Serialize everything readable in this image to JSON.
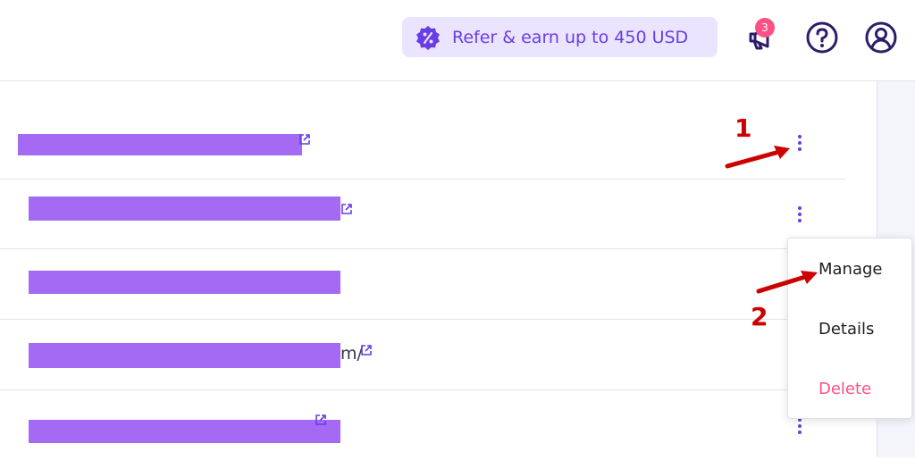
{
  "header": {
    "refer_label": "Refer & earn up to 450 USD",
    "notification_count": "3",
    "icons": [
      "discount-badge-icon",
      "megaphone-icon",
      "help-icon",
      "account-icon"
    ]
  },
  "rows": [
    {
      "url_visible": "",
      "has_external_link": true
    },
    {
      "url_visible": "",
      "has_external_link": true
    },
    {
      "url_visible": "",
      "has_external_link": false
    },
    {
      "url_visible": "m/",
      "has_external_link": true
    },
    {
      "url_visible": "",
      "has_external_link": true
    }
  ],
  "menu": {
    "manage": "Manage",
    "details": "Details",
    "delete": "Delete"
  },
  "annotations": {
    "step1": "1",
    "step2": "2"
  },
  "colors": {
    "accent": "#673de6",
    "accent_light": "#ebe4ff",
    "redaction": "#a56af4",
    "danger": "#fc5185",
    "annotation": "#cc0000"
  }
}
